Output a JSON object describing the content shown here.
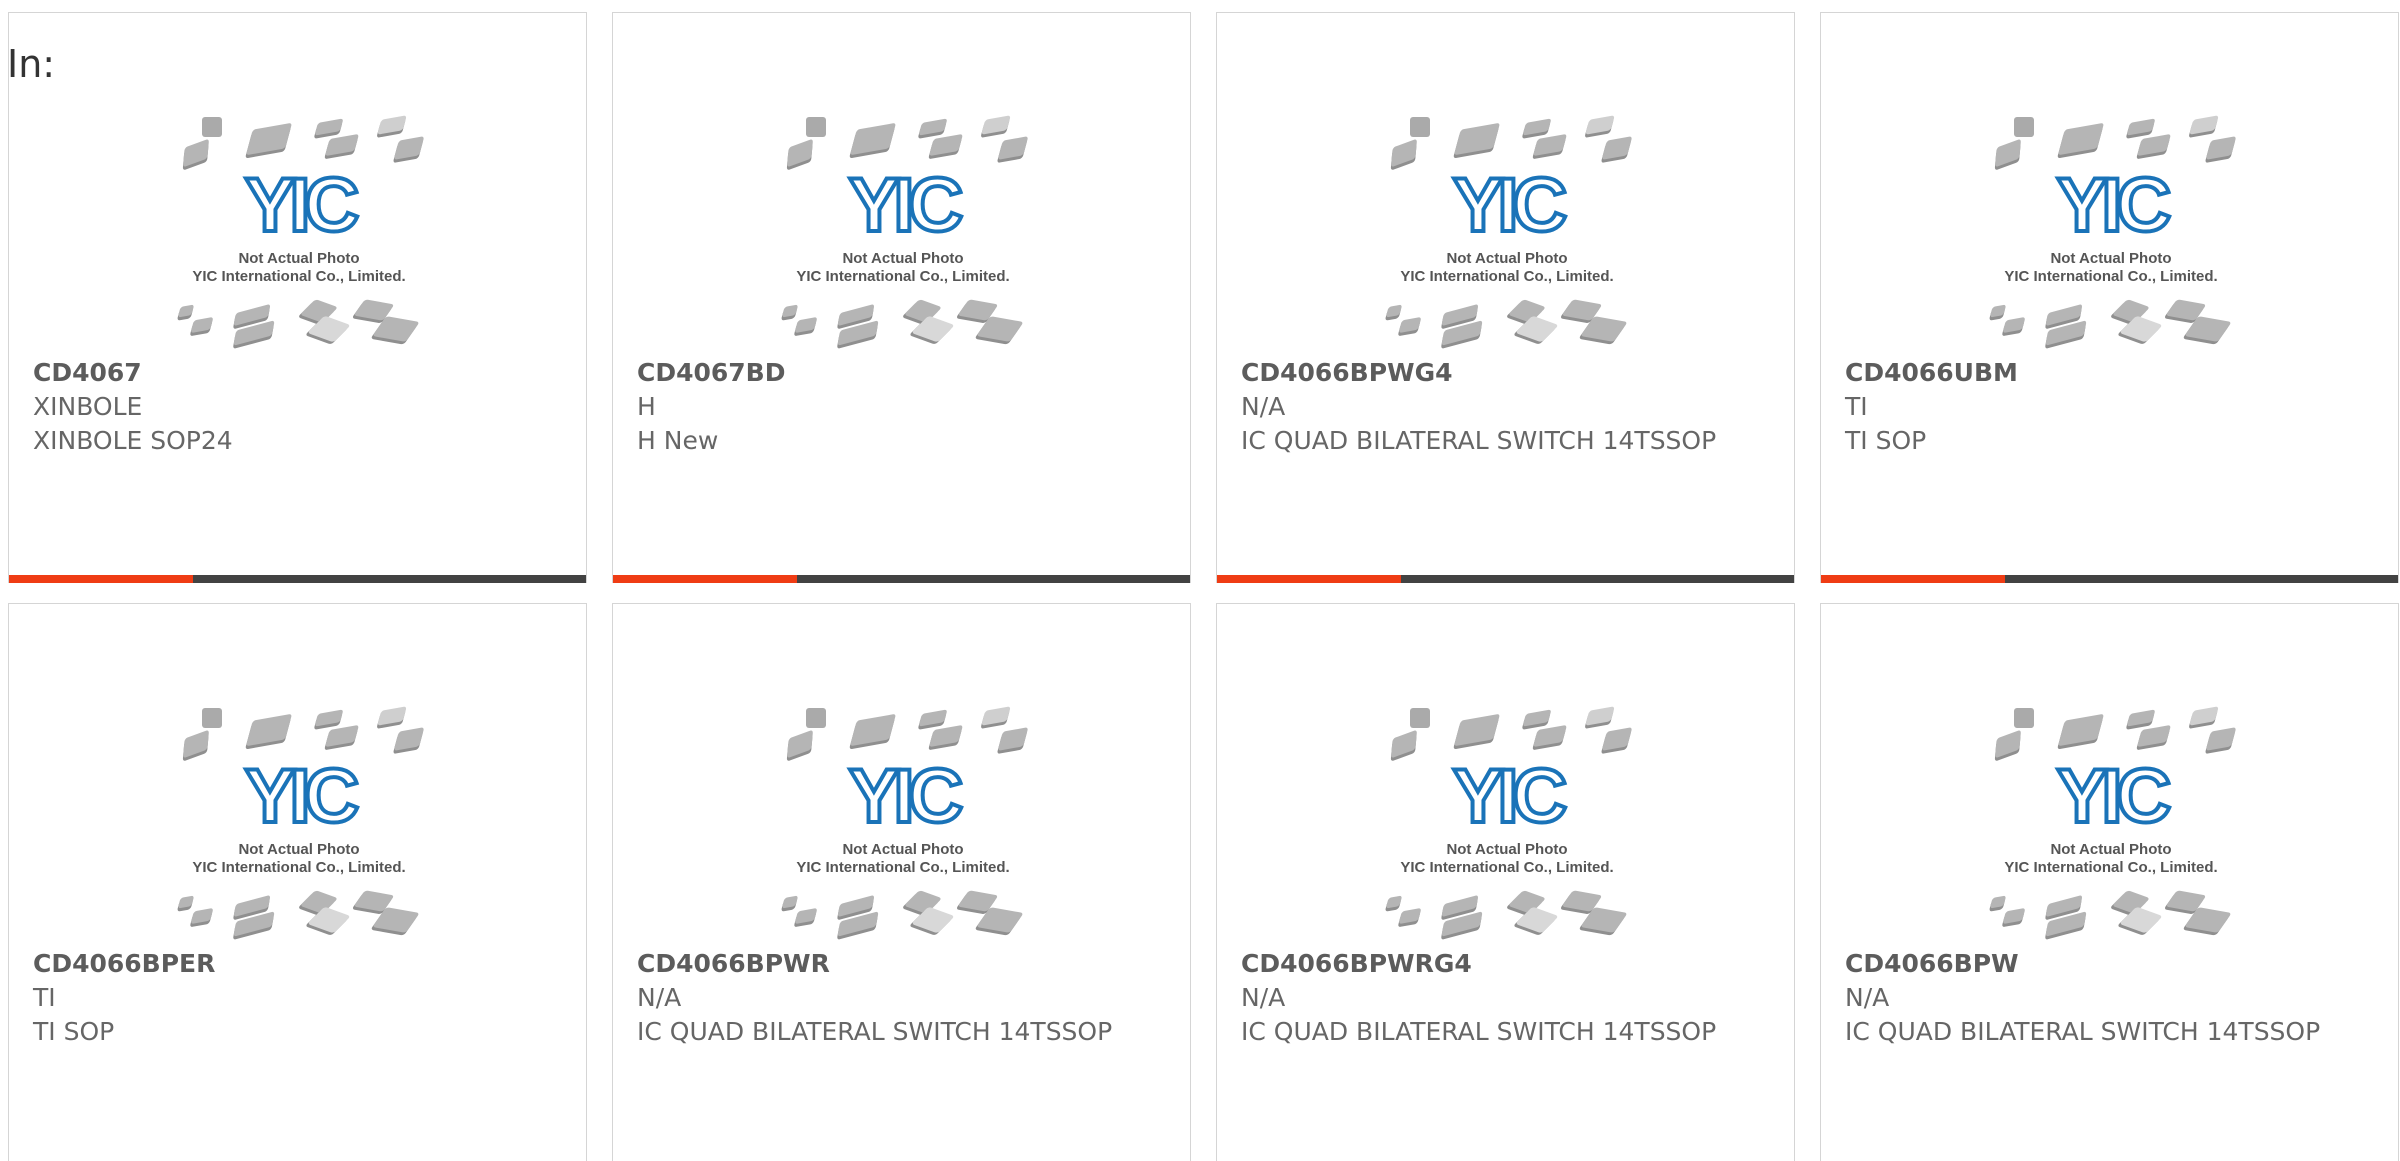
{
  "filter": {
    "label": "In:"
  },
  "colors": {
    "accent": "#ef3c14",
    "bar": "#424242",
    "logo_blue": "#1a73b8",
    "chip_gray": "#b5b5b5"
  },
  "watermark": {
    "logo_text": "YIC",
    "line1": "Not Actual Photo",
    "line2": "YIC International Co., Limited."
  },
  "products": [
    {
      "part": "CD4067",
      "manufacturer": "XINBOLE",
      "description": "XINBOLE SOP24",
      "bar_progress": 0.32
    },
    {
      "part": "CD4067BD",
      "manufacturer": "H",
      "description": "H New",
      "bar_progress": 0.32
    },
    {
      "part": "CD4066BPWG4",
      "manufacturer": "N/A",
      "description": "IC QUAD BILATERAL SWITCH 14TSSOP",
      "bar_progress": 0.32
    },
    {
      "part": "CD4066UBM",
      "manufacturer": "TI",
      "description": "TI SOP",
      "bar_progress": 0.32
    },
    {
      "part": "CD4066BPER",
      "manufacturer": "TI",
      "description": "TI SOP"
    },
    {
      "part": "CD4066BPWR",
      "manufacturer": "N/A",
      "description": "IC QUAD BILATERAL SWITCH 14TSSOP"
    },
    {
      "part": "CD4066BPWRG4",
      "manufacturer": "N/A",
      "description": "IC QUAD BILATERAL SWITCH 14TSSOP"
    },
    {
      "part": "CD4066BPW",
      "manufacturer": "N/A",
      "description": "IC QUAD BILATERAL SWITCH 14TSSOP"
    }
  ]
}
